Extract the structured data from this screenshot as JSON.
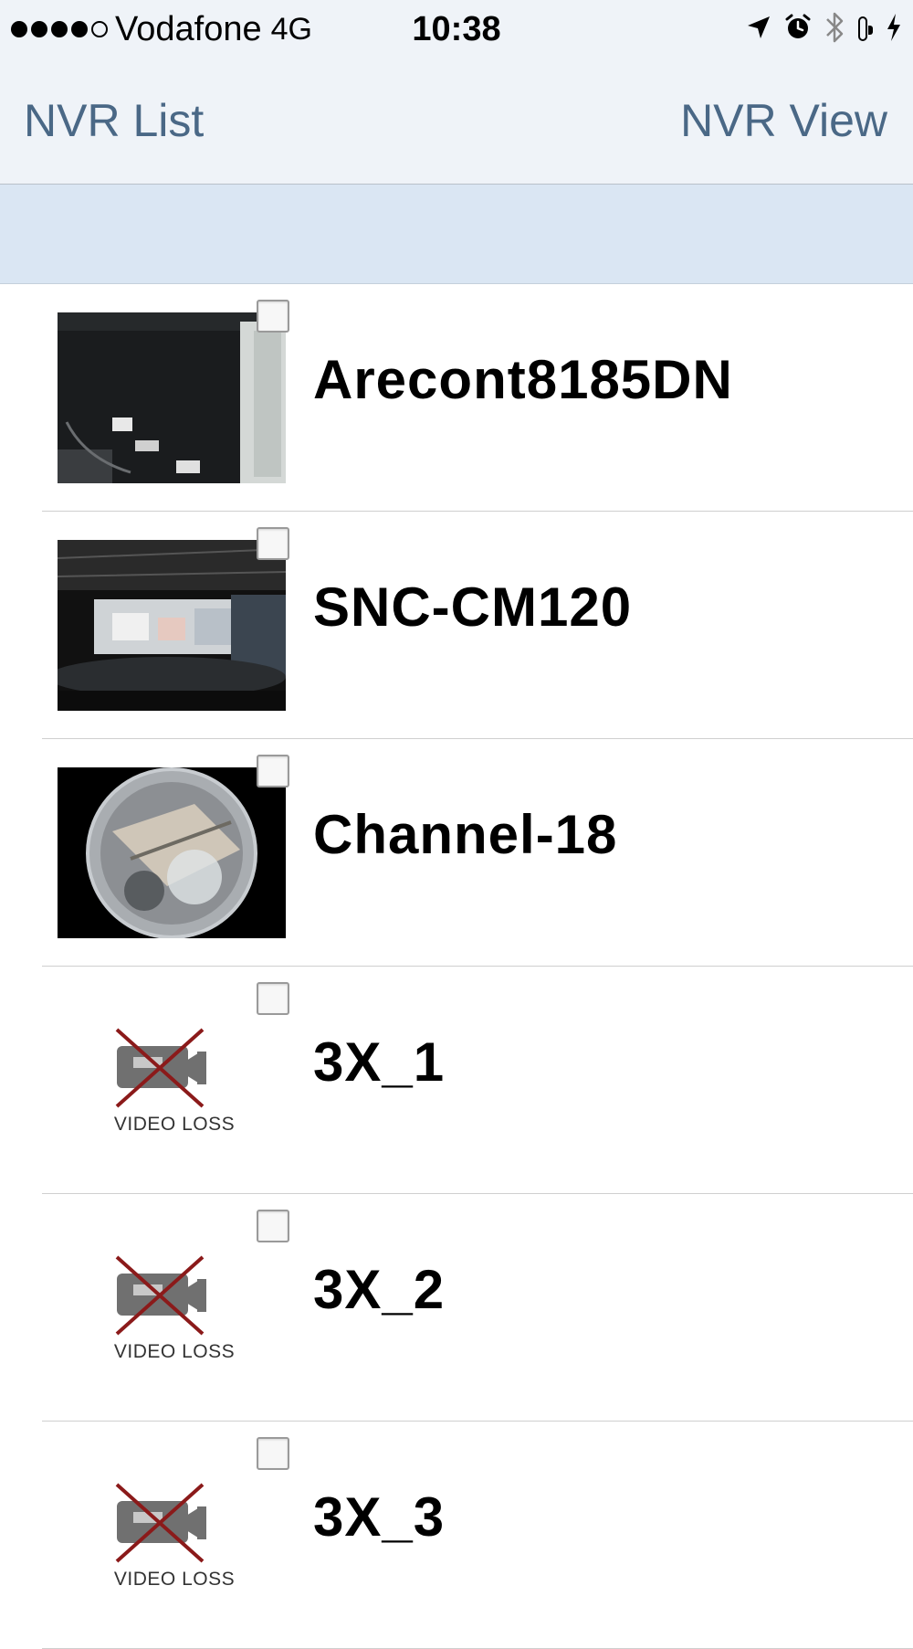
{
  "status_bar": {
    "carrier": "Vodafone",
    "network": "4G",
    "time": "10:38",
    "signal_bars": 4,
    "battery_level": 1.0,
    "battery_color": "#4cd964",
    "icons": [
      "location-arrow-icon",
      "alarm-clock-icon",
      "bluetooth-icon",
      "battery-icon",
      "charging-bolt-icon"
    ]
  },
  "nav": {
    "left_label": "NVR List",
    "right_label": "NVR View",
    "tint_color": "#4a6886"
  },
  "cameras": [
    {
      "name": "Arecont8185DN",
      "checked": false,
      "thumbnail": "camera-snapshot"
    },
    {
      "name": "SNC-CM120",
      "checked": false,
      "thumbnail": "camera-snapshot"
    },
    {
      "name": "Channel-18",
      "checked": false,
      "thumbnail": "fisheye-snapshot"
    },
    {
      "name": "3X_1",
      "checked": false,
      "thumbnail": "video-loss",
      "video_loss_label": "VIDEO LOSS"
    },
    {
      "name": "3X_2",
      "checked": false,
      "thumbnail": "video-loss",
      "video_loss_label": "VIDEO LOSS"
    },
    {
      "name": "3X_3",
      "checked": false,
      "thumbnail": "video-loss",
      "video_loss_label": "VIDEO LOSS"
    }
  ]
}
